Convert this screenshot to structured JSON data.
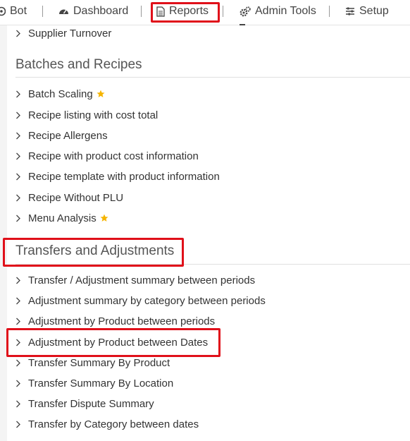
{
  "nav": {
    "bot": "Bot",
    "dashboard": "Dashboard",
    "reports": "Reports",
    "admin_tools": "Admin Tools",
    "setup": "Setup"
  },
  "sections": {
    "top_item": "Supplier Turnover",
    "batches": {
      "title": "Batches and Recipes",
      "items": [
        "Batch Scaling",
        "Recipe listing with cost total",
        "Recipe Allergens",
        "Recipe with product cost information",
        "Recipe template with product information",
        "Recipe Without PLU",
        "Menu Analysis"
      ]
    },
    "transfers": {
      "title": "Transfers and Adjustments",
      "items": [
        "Transfer / Adjustment summary between periods",
        "Adjustment summary by category between periods",
        "Adjustment by Product between periods",
        "Adjustment by Product between Dates",
        "Transfer Summary By Product",
        "Transfer Summary By Location",
        "Transfer Dispute Summary",
        "Transfer by Category between dates"
      ]
    }
  },
  "colors": {
    "highlight": "#e0101a",
    "star": "#f5b400"
  }
}
